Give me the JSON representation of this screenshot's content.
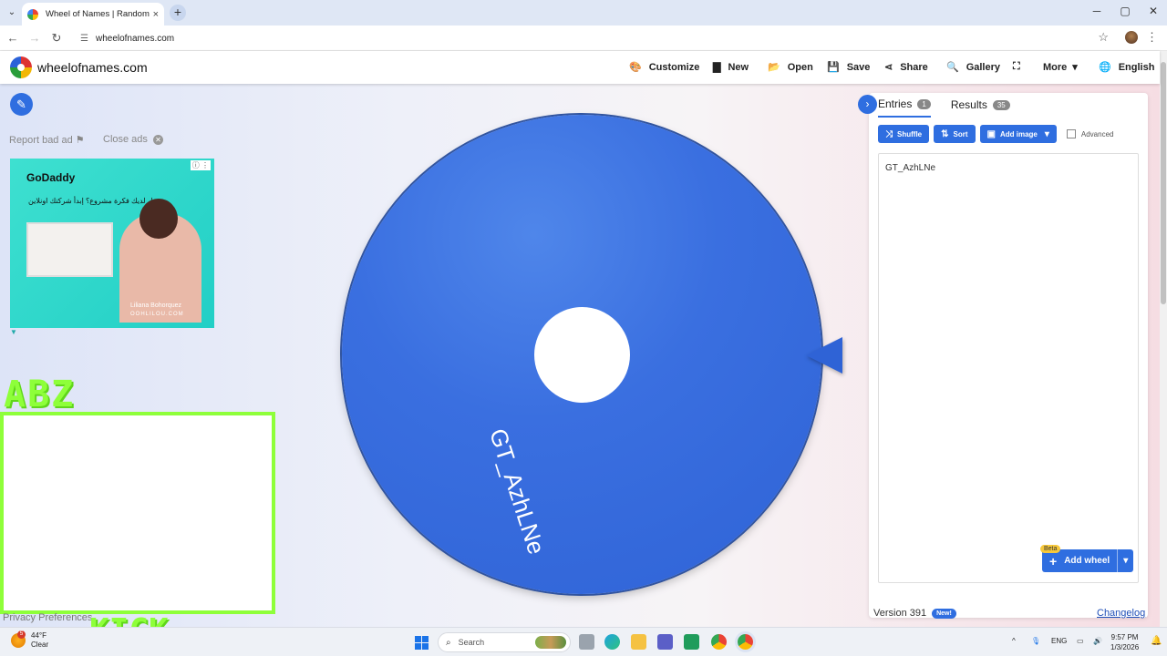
{
  "browser": {
    "tab_title": "Wheel of Names | Random nam",
    "tab_close": "×",
    "new_tab": "+",
    "url": "wheelofnames.com",
    "window_controls": [
      "─",
      "▢",
      "✕"
    ]
  },
  "header": {
    "brand": "wheelofnames.com",
    "menu": [
      {
        "label": "Customize",
        "icon": "🎨"
      },
      {
        "label": "New",
        "icon": "▇"
      },
      {
        "label": "Open",
        "icon": "📂"
      },
      {
        "label": "Save",
        "icon": "💾"
      },
      {
        "label": "Share",
        "icon": "⋖"
      },
      {
        "label": "Gallery",
        "icon": "🔍"
      },
      {
        "label": "",
        "icon": "⛶"
      },
      {
        "label": "More",
        "icon": "▾"
      },
      {
        "label": "English",
        "icon": "🌐"
      }
    ]
  },
  "left": {
    "report_bad_ad": "Report bad ad",
    "flag_icon": "⚑",
    "close_ads": "Close ads",
    "close_x": "✕",
    "ad": {
      "brand": "GoDaddy",
      "arabic_text": "هل لديك فكرة مشروع؟ إبدأ شركتك اونلاين",
      "caption": "Liliana Bohorquez",
      "caption2": "OOHLILOU.COM"
    },
    "abz": "ABZ",
    "kick": "KICK",
    "privacy": "Privacy Preferences"
  },
  "wheel": {
    "label": "GT_AzhLNe",
    "color": "#3a6fe0"
  },
  "panel": {
    "tabs": [
      {
        "label": "Entries",
        "count": "1"
      },
      {
        "label": "Results",
        "count": "35"
      }
    ],
    "buttons": {
      "shuffle": "Shuffle",
      "sort": "Sort",
      "add_image": "Add image",
      "advanced": "Advanced"
    },
    "entries_text": "GT_AzhLNe",
    "beta": "Beta",
    "add_wheel": "Add wheel",
    "version": "Version 391",
    "new_badge": "New!",
    "changelog": "Changelog"
  },
  "taskbar": {
    "temp": "44°F",
    "weather": "Clear",
    "weather_badge": "5",
    "search": "Search",
    "lang": "ENG",
    "time": "9:57 PM",
    "date": "1/3/2026"
  },
  "colors": {
    "accent": "#2f6ee0",
    "kick_green": "#8eff3a"
  }
}
